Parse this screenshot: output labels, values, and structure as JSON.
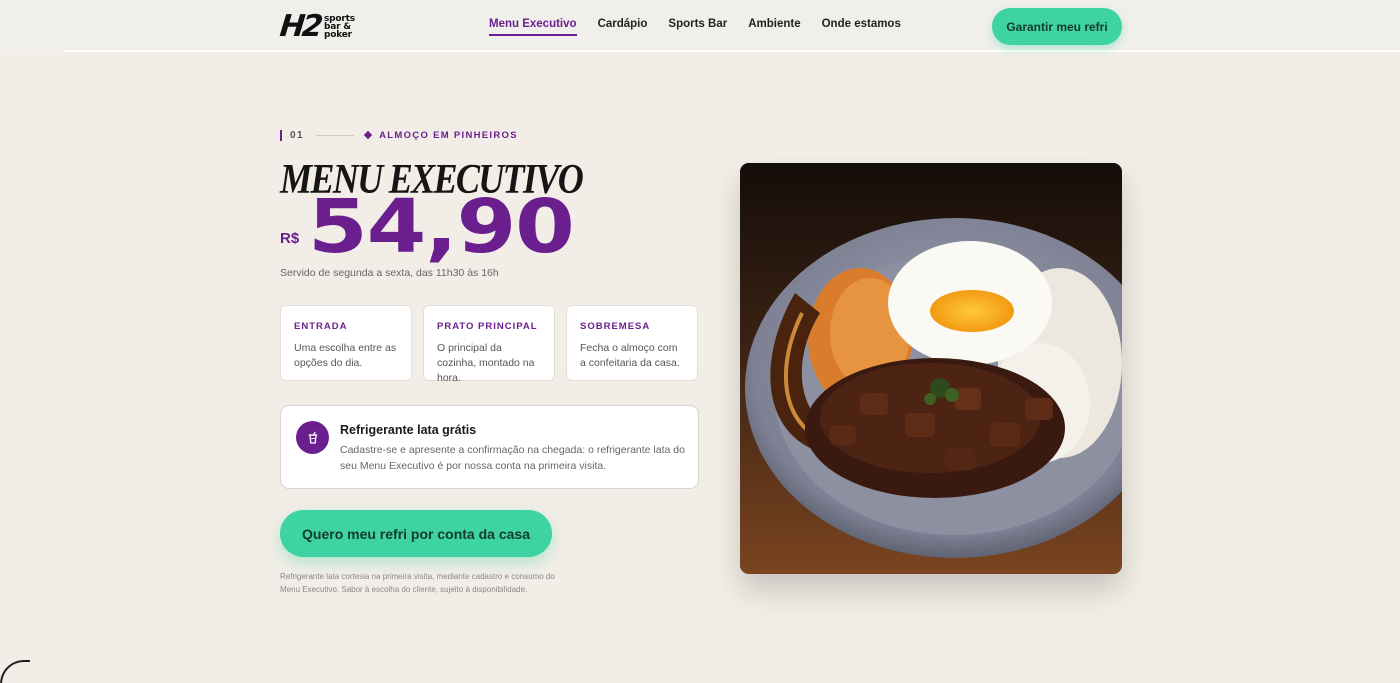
{
  "brand": {
    "logo_mark": "H2",
    "logo_words": [
      "sports",
      "bar &",
      "poker"
    ]
  },
  "nav": {
    "items": [
      {
        "label": "Menu Executivo",
        "active": true
      },
      {
        "label": "Cardápio",
        "active": false
      },
      {
        "label": "Sports Bar",
        "active": false
      },
      {
        "label": "Ambiente",
        "active": false
      },
      {
        "label": "Onde estamos",
        "active": false
      }
    ],
    "cta_label": "Garantir meu refri"
  },
  "hero": {
    "section_number": "01",
    "eyebrow": "ALMOÇO EM PINHEIROS",
    "title": "MENU EXECUTIVO",
    "currency": "R$",
    "price": "54,90",
    "schedule": "Servido de segunda a sexta, das 11h30 às 16h"
  },
  "courses": [
    {
      "title": "ENTRADA",
      "text": "Uma escolha entre as opções do dia."
    },
    {
      "title": "PRATO PRINCIPAL",
      "text": "O principal da cozinha, montado na hora."
    },
    {
      "title": "SOBREMESA",
      "text": "Fecha o almoço com a confeitaria da casa."
    }
  ],
  "promo": {
    "icon": "drink-cup-icon",
    "title": "Refrigerante lata grátis",
    "text": "Cadastre-se e apresente a confirmação na chegada: o refrigerante lata do seu Menu Executivo é por nossa conta na primeira visita."
  },
  "cta": {
    "label": "Quero meu refri por conta da casa",
    "disclaimer": "Refrigerante lata cortesia na primeira visita, mediante cadastro e consumo do Menu Executivo. Sabor à escolha do cliente, sujeito à disponibilidade."
  },
  "colors": {
    "accent": "#6b1f8f",
    "cta_green": "#3ed3a2",
    "background": "#f2eee7"
  }
}
